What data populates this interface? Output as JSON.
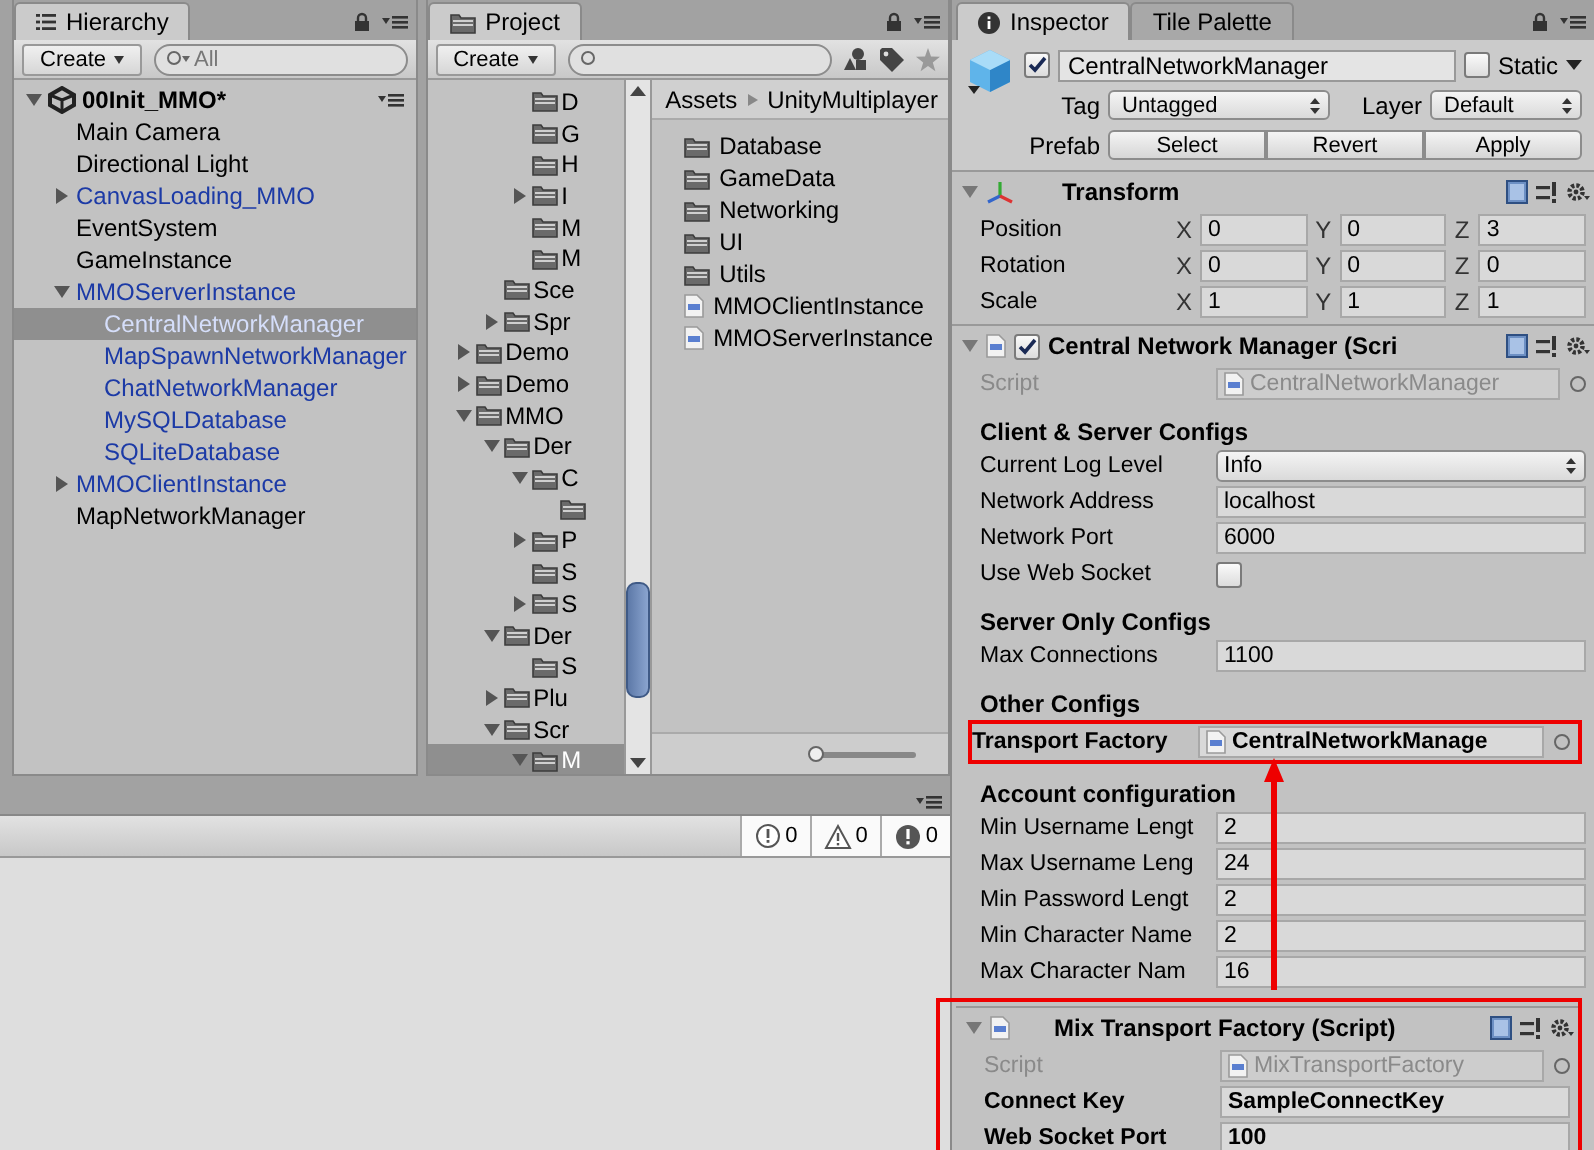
{
  "hierarchy": {
    "tab": "Hierarchy",
    "create": "Create",
    "search_placeholder": "All",
    "tree": [
      {
        "label": "00Init_MMO*",
        "kind": "scene",
        "prefab": false,
        "selected": false,
        "expanded": true,
        "children": [
          {
            "label": "Main Camera",
            "kind": "object",
            "prefab": false,
            "selected": false
          },
          {
            "label": "Directional Light",
            "kind": "object",
            "prefab": false,
            "selected": false
          },
          {
            "label": "CanvasLoading_MMO",
            "kind": "object",
            "prefab": true,
            "selected": false,
            "expanded": false
          },
          {
            "label": "EventSystem",
            "kind": "object",
            "prefab": false,
            "selected": false
          },
          {
            "label": "GameInstance",
            "kind": "object",
            "prefab": false,
            "selected": false
          },
          {
            "label": "MMOServerInstance",
            "kind": "object",
            "prefab": true,
            "selected": false,
            "expanded": true,
            "children": [
              {
                "label": "CentralNetworkManager",
                "kind": "object",
                "prefab": true,
                "selected": true
              },
              {
                "label": "MapSpawnNetworkManager",
                "kind": "object",
                "prefab": true,
                "selected": false
              },
              {
                "label": "ChatNetworkManager",
                "kind": "object",
                "prefab": true,
                "selected": false
              },
              {
                "label": "MySQLDatabase",
                "kind": "object",
                "prefab": true,
                "selected": false
              },
              {
                "label": "SQLiteDatabase",
                "kind": "object",
                "prefab": true,
                "selected": false
              }
            ]
          },
          {
            "label": "MMOClientInstance",
            "kind": "object",
            "prefab": true,
            "selected": false,
            "expanded": false
          },
          {
            "label": "MapNetworkManager",
            "kind": "object",
            "prefab": false,
            "selected": false
          }
        ]
      }
    ]
  },
  "project": {
    "tab": "Project",
    "create": "Create",
    "tree": [
      {
        "children": [
          {
            "children": [
              {
                "label": "D",
                "selected": false
              },
              {
                "label": "G",
                "selected": false
              },
              {
                "label": "H",
                "selected": false
              },
              {
                "label": "I",
                "selected": false,
                "expanded": false
              },
              {
                "label": "M",
                "selected": false
              },
              {
                "label": "M",
                "selected": false
              }
            ]
          },
          {
            "label": "Sce",
            "selected": false
          },
          {
            "label": "Spr",
            "selected": false,
            "expanded": false
          }
        ]
      },
      {
        "label": "Demo",
        "selected": false,
        "expanded": false
      },
      {
        "label": "Demo",
        "selected": false,
        "expanded": false
      },
      {
        "label": "MMO",
        "selected": false,
        "expanded": true,
        "children": [
          {
            "label": "Der",
            "selected": false,
            "expanded": true,
            "children": [
              {
                "label": "C",
                "selected": false,
                "expanded": true,
                "children": [
                  {
                    "selected": false
                  }
                ]
              },
              {
                "label": "P",
                "selected": false,
                "expanded": false
              },
              {
                "label": "S",
                "selected": false
              },
              {
                "label": "S",
                "selected": false,
                "expanded": false
              }
            ]
          },
          {
            "label": "Der",
            "selected": false,
            "expanded": true,
            "children": [
              {
                "label": "S",
                "selected": false
              }
            ]
          },
          {
            "label": "Plu",
            "selected": false,
            "expanded": false
          },
          {
            "label": "Scr",
            "selected": false,
            "expanded": true,
            "children": [
              {
                "label": "M",
                "selected": true,
                "expanded": true
              }
            ]
          }
        ]
      }
    ],
    "breadcrumb": [
      "Assets",
      "UnityMultiplayer"
    ],
    "items": [
      {
        "label": "Database",
        "kind": "folder"
      },
      {
        "label": "GameData",
        "kind": "folder"
      },
      {
        "label": "Networking",
        "kind": "folder"
      },
      {
        "label": "UI",
        "kind": "folder"
      },
      {
        "label": "Utils",
        "kind": "folder"
      },
      {
        "label": "MMOClientInstance",
        "kind": "script"
      },
      {
        "label": "MMOServerInstance",
        "kind": "script"
      }
    ],
    "zoom_slider": {
      "level": 0
    }
  },
  "console": {
    "counts": [
      {
        "kind": "info",
        "count": "0"
      },
      {
        "kind": "warning",
        "count": "0"
      },
      {
        "kind": "error",
        "count": "0"
      }
    ]
  },
  "inspector": {
    "tabs": [
      {
        "label": "Inspector",
        "selected": true
      },
      {
        "label": "Tile Palette",
        "selected": false
      }
    ],
    "object": {
      "active": true,
      "name": "CentralNetworkManager",
      "static_label": "Static",
      "static": false,
      "tag_label": "Tag",
      "tag": "Untagged",
      "layer_label": "Layer",
      "layer": "Default",
      "prefab_label": "Prefab",
      "prefab_buttons": [
        "Select",
        "Revert",
        "Apply"
      ]
    },
    "transform": {
      "title": "Transform",
      "expanded": true,
      "rows": [
        {
          "label": "Position",
          "values": [
            {
              "axis": "X",
              "value": "0"
            },
            {
              "axis": "Y",
              "value": "0"
            },
            {
              "axis": "Z",
              "value": "3"
            }
          ]
        },
        {
          "label": "Rotation",
          "values": [
            {
              "axis": "X",
              "value": "0"
            },
            {
              "axis": "Y",
              "value": "0"
            },
            {
              "axis": "Z",
              "value": "0"
            }
          ]
        },
        {
          "label": "Scale",
          "values": [
            {
              "axis": "X",
              "value": "1"
            },
            {
              "axis": "Y",
              "value": "1"
            },
            {
              "axis": "Z",
              "value": "1"
            }
          ]
        }
      ]
    },
    "components": [
      {
        "title": "Central Network Manager (Scri",
        "expanded": true,
        "highlighted": false,
        "toggle": {
          "checked": true
        },
        "script_label": "Script",
        "script": "CentralNetworkManager",
        "groups": [
          {
            "heading": "Client & Server Configs",
            "fields": [
              {
                "label": "Current Log Level",
                "kind": "dropdown",
                "value": "Info",
                "overridden": false,
                "highlighted": false
              },
              {
                "label": "Network Address",
                "kind": "text",
                "value": "localhost",
                "overridden": false,
                "highlighted": false
              },
              {
                "label": "Network Port",
                "kind": "text",
                "value": "6000",
                "overridden": false,
                "highlighted": false
              },
              {
                "label": "Use Web Socket",
                "kind": "checkbox",
                "checked": false,
                "overridden": false,
                "highlighted": false
              }
            ]
          },
          {
            "heading": "Server Only Configs",
            "fields": [
              {
                "label": "Max Connections",
                "kind": "text",
                "value": "1100",
                "overridden": false,
                "highlighted": false
              }
            ]
          },
          {
            "heading": "Other Configs",
            "fields": [
              {
                "label": "Transport Factory",
                "kind": "object",
                "value": "CentralNetworkManage",
                "overridden": true,
                "highlighted": true
              }
            ]
          },
          {
            "heading": "Account configuration",
            "fields": [
              {
                "label": "Min Username Lengt",
                "kind": "text",
                "value": "2",
                "overridden": false,
                "highlighted": false
              },
              {
                "label": "Max Username Leng",
                "kind": "text",
                "value": "24",
                "overridden": false,
                "highlighted": false
              },
              {
                "label": "Min Password Lengt",
                "kind": "text",
                "value": "2",
                "overridden": false,
                "highlighted": false
              },
              {
                "label": "Min Character Name",
                "kind": "text",
                "value": "2",
                "overridden": false,
                "highlighted": false
              },
              {
                "label": "Max Character Nam",
                "kind": "text",
                "value": "16",
                "overridden": false,
                "highlighted": false
              }
            ]
          }
        ]
      },
      {
        "title": "Mix Transport Factory (Script)",
        "expanded": true,
        "highlighted": true,
        "script_label": "Script",
        "script": "MixTransportFactory",
        "groups": [
          {
            "fields": [
              {
                "label": "Connect Key",
                "kind": "text",
                "value": "SampleConnectKey",
                "overridden": true,
                "highlighted": false
              },
              {
                "label": "Web Socket Port",
                "kind": "text",
                "value": "100",
                "overridden": true,
                "highlighted": false
              }
            ]
          }
        ]
      }
    ]
  }
}
